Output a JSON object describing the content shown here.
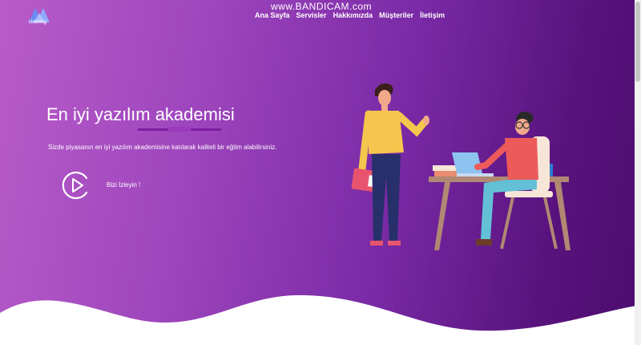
{
  "brand": {
    "name": "Udemig",
    "logo_icon": "mountain-logo-icon"
  },
  "watermark": "www.BANDICAM.com",
  "nav": {
    "items": [
      {
        "label": "Ana Sayfa"
      },
      {
        "label": "Servisler"
      },
      {
        "label": "Hakkımızda"
      },
      {
        "label": "Müşteriler"
      },
      {
        "label": "İletişim"
      }
    ]
  },
  "hero": {
    "title": "En iyi yazılım akademisi",
    "subtitle": "Sizde piyasanın en iyi yazılım akademisine katılarak kaliteli bir eğtim alabilirsiniz.",
    "watch_label": "Bizi İzleyin !",
    "play_icon": "play-circle-icon",
    "illustration": "office-people-illustration"
  },
  "colors": {
    "gradient_start": "#b85cc9",
    "gradient_end": "#4c0c70",
    "accent": "#7d1fa1"
  }
}
